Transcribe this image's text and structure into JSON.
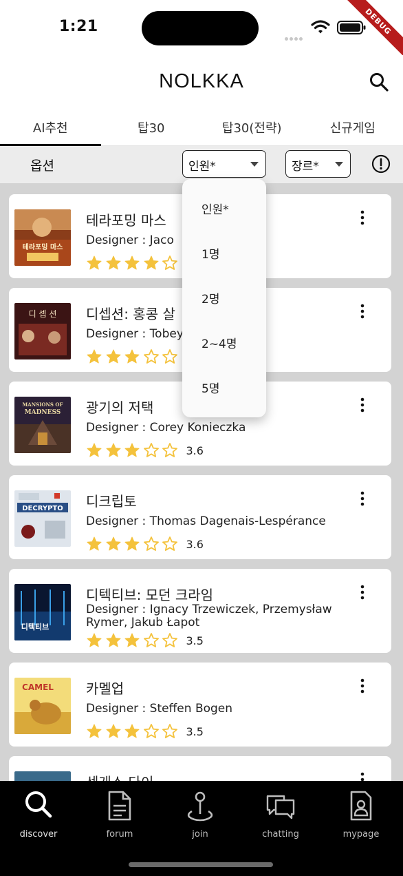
{
  "status_bar": {
    "time": "1:21",
    "debug_label": "DEBUG"
  },
  "header": {
    "title": "NOLKKA"
  },
  "tabs": [
    {
      "label": "AI추천",
      "active": true
    },
    {
      "label": "탑30",
      "active": false
    },
    {
      "label": "탑30(전략)",
      "active": false
    },
    {
      "label": "신규게임",
      "active": false
    }
  ],
  "options": {
    "label": "옵션",
    "people_select": "인원*",
    "genre_select": "장르*"
  },
  "dropdown": {
    "items": [
      "인원*",
      "1명",
      "2명",
      "2~4명",
      "5명"
    ]
  },
  "games": [
    {
      "title": "테라포밍 마스",
      "designer": "Designer : Jaco",
      "rating": 4.0,
      "rating_text": "",
      "thumb_color": "#b5652b",
      "thumb_text": "테라포밍 마스"
    },
    {
      "title": "디셉션: 홍콩 살",
      "designer": "Designer : Tobey",
      "rating": 3.0,
      "rating_text": "",
      "thumb_color": "#6b2020",
      "thumb_text": "디 셉 션"
    },
    {
      "title": "광기의 저택",
      "designer": "Designer : Corey Konieczka",
      "rating": 3.6,
      "rating_text": "3.6",
      "thumb_color": "#3a2a4e",
      "thumb_text": "MANSIONS OF MADNESS"
    },
    {
      "title": "디크립토",
      "designer": "Designer : Thomas Dagenais-Lespérance",
      "rating": 3.6,
      "rating_text": "3.6",
      "thumb_color": "#d9dfe6",
      "thumb_text": "DECRYPTO"
    },
    {
      "title": "디텍티브: 모던 크라임",
      "designer": "Designer : Ignacy Trzewiczek, Przemysław Rymer, Jakub Łapot",
      "rating": 3.5,
      "rating_text": "3.5",
      "thumb_color": "#0e1e3a",
      "thumb_text": "디텍티브"
    },
    {
      "title": "카멜업",
      "designer": "Designer : Steffen Bogen",
      "rating": 3.5,
      "rating_text": "3.5",
      "thumb_color": "#e8c24a",
      "thumb_text": "CAMEL"
    },
    {
      "title": "센게스 다이",
      "designer": "",
      "rating": 0,
      "rating_text": "",
      "thumb_color": "#3a6a8a",
      "thumb_text": ""
    }
  ],
  "colors": {
    "star": "#f4c23c",
    "nav_bg": "#000000",
    "options_bg": "#ececec",
    "list_bg": "#d3d3d3"
  },
  "bottom_nav": [
    {
      "label": "discover",
      "icon": "search-icon",
      "active": true
    },
    {
      "label": "forum",
      "icon": "document-icon",
      "active": false
    },
    {
      "label": "join",
      "icon": "map-pin-icon",
      "active": false
    },
    {
      "label": "chatting",
      "icon": "chat-bubbles-icon",
      "active": false
    },
    {
      "label": "mypage",
      "icon": "profile-card-icon",
      "active": false
    }
  ]
}
